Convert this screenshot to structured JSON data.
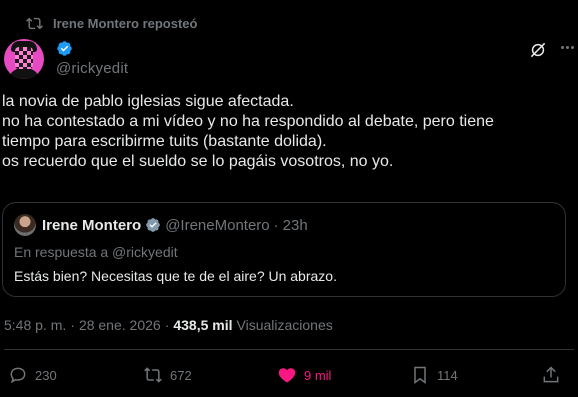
{
  "repost": {
    "label": "Irene Montero reposteó"
  },
  "author": {
    "handle": "@rickyedit"
  },
  "tweet": {
    "lines": [
      "la novia de pablo iglesias sigue afectada.",
      "no ha contestado a mi vídeo y no ha respondido al debate, pero tiene",
      "tiempo para escribirme tuits (bastante dolida).",
      "os recuerdo que el sueldo se lo pagáis vosotros, no yo."
    ]
  },
  "quote": {
    "name": "Irene Montero",
    "handle": "@IreneMontero",
    "separator": "·",
    "time": "23h",
    "reply_to": "En respuesta a @rickyedit",
    "text": "Estás bien? Necesitas que te de el aire? Un abrazo."
  },
  "meta": {
    "time": "5:48 p. m.",
    "sep1": "·",
    "date": "28 ene. 2026",
    "sep2": "·",
    "views": "438,5 mil",
    "views_label": "Visualizaciones"
  },
  "actions": {
    "replies": "230",
    "reposts": "672",
    "likes": "9 mil",
    "bookmarks": "114"
  },
  "colors": {
    "background": "#000000",
    "text": "#e7e9ea",
    "muted": "#71767b",
    "border": "#2f3336",
    "like": "#f91880",
    "verified": "#1d9bf0"
  },
  "icons": [
    "repost-icon",
    "verified-icon",
    "grok-icon",
    "more-icon",
    "reply-icon",
    "like-icon",
    "bookmark-icon",
    "share-icon"
  ]
}
